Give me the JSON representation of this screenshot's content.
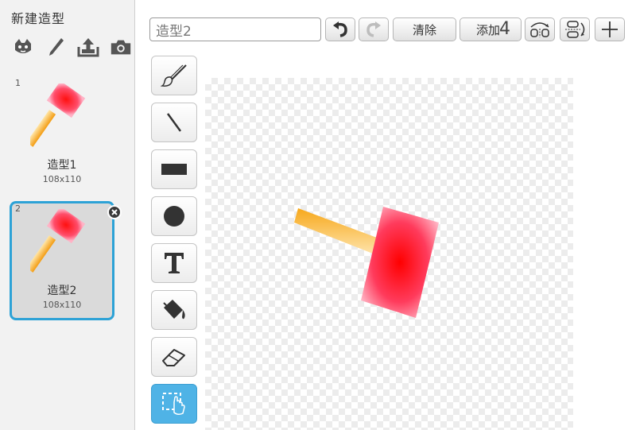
{
  "sidebar": {
    "new_costume_label": "新建造型",
    "costumes": [
      {
        "number": "1",
        "name": "造型1",
        "size": "108x110"
      },
      {
        "number": "2",
        "name": "造型2",
        "size": "108x110"
      }
    ]
  },
  "toolbar": {
    "name_value": "造型2",
    "clear_label": "清除",
    "add_label": "添加",
    "add_overlay": "4"
  },
  "tools": [
    "brush",
    "line",
    "rectangle",
    "ellipse",
    "text",
    "fill",
    "eraser",
    "select"
  ],
  "colors": {
    "selection_border": "#2da2d6",
    "active_tool": "#4fb3e6",
    "hammer_head": "#ff1a1a",
    "hammer_handle": "#f5a623"
  }
}
